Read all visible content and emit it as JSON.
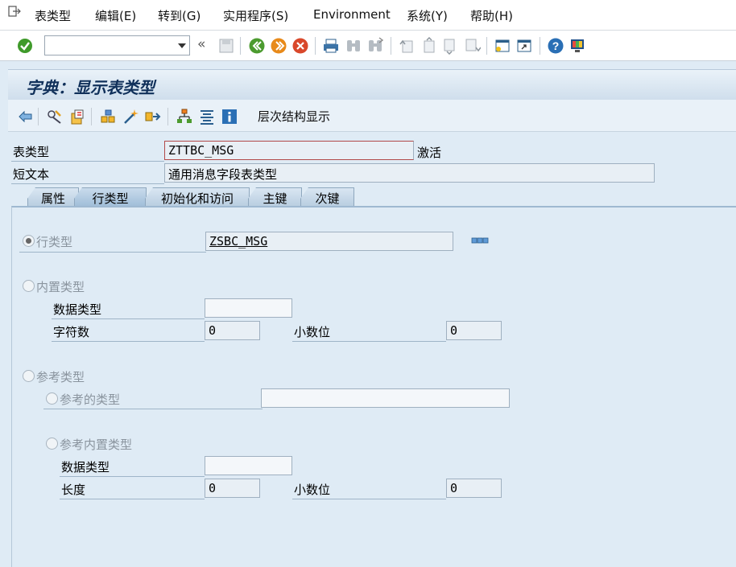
{
  "menu": {
    "items": [
      "表类型",
      "编辑(E)",
      "转到(G)",
      "实用程序(S)",
      "Environment",
      "系统(Y)",
      "帮助(H)"
    ]
  },
  "system_toolbar": {
    "command_value": "",
    "icons": [
      "enter-icon",
      "back-arrows-icon",
      "save-icon",
      "back-icon",
      "exit-icon",
      "cancel-icon",
      "print-icon",
      "find-icon",
      "find-next-icon",
      "first-page-icon",
      "prev-page-icon",
      "next-page-icon",
      "last-page-icon",
      "new-session-icon",
      "shortcut-icon",
      "help-icon",
      "layout-icon"
    ],
    "back_glyph": "«"
  },
  "title": "字典：显示表类型",
  "app_toolbar": {
    "hierarchy_label": "层次结构显示"
  },
  "header": {
    "table_type_label": "表类型",
    "table_type_value": "ZTTBC_MSG",
    "status": "激活",
    "short_text_label": "短文本",
    "short_text_value": "通用消息字段表类型"
  },
  "tabs": [
    {
      "label": "属性",
      "active": false
    },
    {
      "label": "行类型",
      "active": true
    },
    {
      "label": "初始化和访问",
      "active": false
    },
    {
      "label": "主键",
      "active": false
    },
    {
      "label": "次键",
      "active": false
    }
  ],
  "row_type": {
    "label": "行类型",
    "value": "ZSBC_MSG",
    "selected": true
  },
  "builtin_type": {
    "label": "内置类型",
    "data_type_label": "数据类型",
    "data_type_value": "",
    "chars_label": "字符数",
    "chars_value": "0",
    "decimals_label": "小数位",
    "decimals_value": "0"
  },
  "reference_type": {
    "label": "参考类型",
    "ref_type_label": "参考的类型",
    "ref_type_value": "",
    "ref_builtin_label": "参考内置类型",
    "data_type_label": "数据类型",
    "data_type_value": "",
    "length_label": "长度",
    "length_value": "0",
    "decimals_label": "小数位",
    "decimals_value": "0"
  },
  "colors": {
    "background": "#dfebf5",
    "title_text": "#10305a",
    "enter_green": "#3f9a2a",
    "back_green": "#4c9b2f",
    "exit_orange": "#e88a1a",
    "cancel_red": "#d9482b",
    "help_blue": "#2a6fb5"
  }
}
